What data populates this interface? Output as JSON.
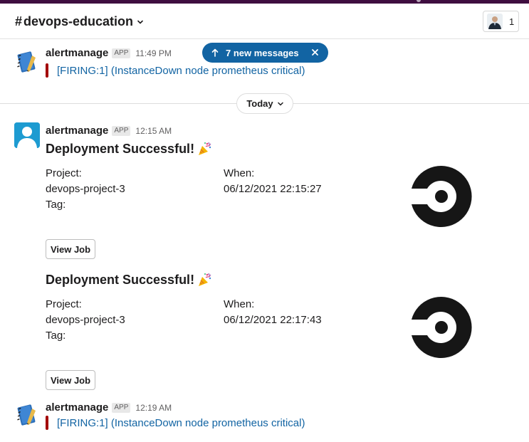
{
  "header": {
    "channel_hash": "#",
    "channel_name": "devops-education",
    "member_count": "1"
  },
  "toast": {
    "label": "7 new messages"
  },
  "day_divider": {
    "label": "Today"
  },
  "messages": [
    {
      "sender": "alertmanage",
      "badge": "APP",
      "time": "11:49 PM",
      "alert_text": "[FIRING:1]  (InstanceDown node prometheus critical)"
    },
    {
      "sender": "alertmanage",
      "badge": "APP",
      "time": "12:15 AM",
      "cards": [
        {
          "title": "Deployment Successful!",
          "project_label": "Project:",
          "project_value": "devops-project-3",
          "tag_label": "Tag:",
          "when_label": "When:",
          "when_value": "06/12/2021 22:15:27",
          "button_label": "View Job"
        },
        {
          "title": "Deployment Successful!",
          "project_label": "Project:",
          "project_value": "devops-project-3",
          "tag_label": "Tag:",
          "when_label": "When:",
          "when_value": "06/12/2021 22:17:43",
          "button_label": "View Job"
        }
      ]
    },
    {
      "sender": "alertmanage",
      "badge": "APP",
      "time": "12:19 AM",
      "alert_text": "[FIRING:1]  (InstanceDown node prometheus critical)"
    }
  ],
  "colors": {
    "link": "#1264a3",
    "alert_bar": "#a30200",
    "toast_bg": "#1264a3",
    "workspace_strip": "#3f0e40"
  },
  "icons": {
    "channel_chevron": "chevron-down-icon",
    "toast_arrow": "arrow-up-icon",
    "toast_close": "close-icon",
    "day_chevron": "chevron-down-icon",
    "party": "party-popper-icon",
    "logo": "circleci-logo",
    "app_avatar": "notebook-icon",
    "user_avatar": "default-avatar-icon"
  }
}
